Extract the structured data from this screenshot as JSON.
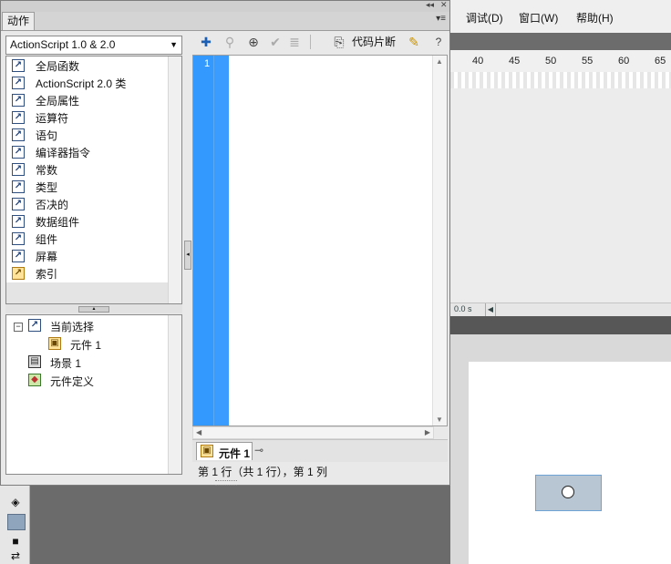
{
  "menubar": {
    "items": [
      "调试(D)",
      "窗口(W)",
      "帮助(H)"
    ]
  },
  "timeline": {
    "ruler": [
      "40",
      "45",
      "50",
      "55",
      "60",
      "65"
    ],
    "time_readout": "0.0 s"
  },
  "panel": {
    "tab_label": "动作",
    "language_select": "ActionScript 1.0 & 2.0",
    "categories": [
      {
        "label": "全局函数"
      },
      {
        "label": "ActionScript 2.0 类"
      },
      {
        "label": "全局属性"
      },
      {
        "label": "运算符"
      },
      {
        "label": "语句"
      },
      {
        "label": "编译器指令"
      },
      {
        "label": "常数"
      },
      {
        "label": "类型"
      },
      {
        "label": "否决的"
      },
      {
        "label": "数据组件"
      },
      {
        "label": "组件"
      },
      {
        "label": "屏幕"
      },
      {
        "label": "索引"
      }
    ],
    "tree": {
      "current_selection": "当前选择",
      "symbol": "元件 1",
      "scene": "场景 1",
      "symbol_definitions": "元件定义"
    },
    "toolbar": {
      "code_snippets": "代码片断"
    },
    "editor": {
      "line_number": "1"
    },
    "script_tab": "元件 1",
    "status_text": "第 1 行（共 1 行），第 1 列"
  },
  "colors": {
    "gutter": "#3399ff",
    "selection": "#8fa4bd"
  }
}
